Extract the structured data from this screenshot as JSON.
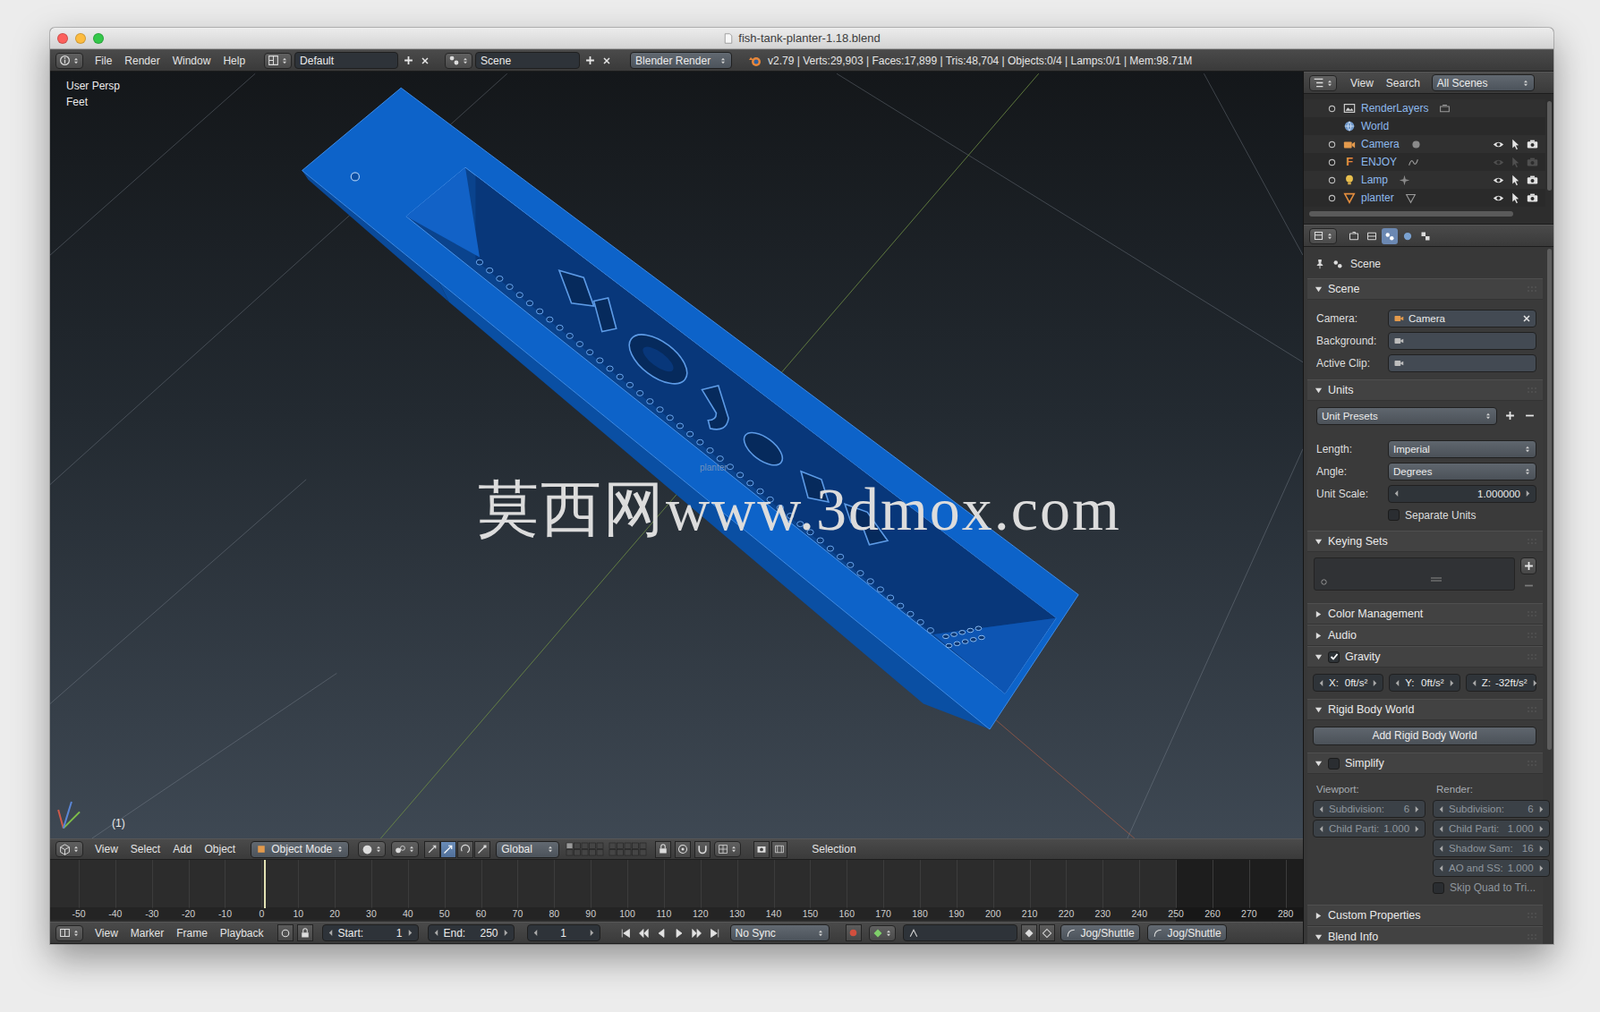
{
  "window": {
    "title": "fish-tank-planter-1.18.blend"
  },
  "info_header": {
    "menus": [
      "File",
      "Render",
      "Window",
      "Help"
    ],
    "layout": "Default",
    "scene": "Scene",
    "engine": "Blender Render",
    "stats": "v2.79 | Verts:29,903 | Faces:17,899 | Tris:48,704 | Objects:0/4 | Lamps:0/1 | Mem:98.71M"
  },
  "viewport": {
    "view": "User Persp",
    "units": "Feet",
    "frame": "(1)",
    "object_label": "planter",
    "watermark": "莫西网www.3dmox.com"
  },
  "viewport_header": {
    "menus": [
      "View",
      "Select",
      "Add",
      "Object"
    ],
    "mode": "Object Mode",
    "orientation": "Global",
    "selection_label": "Selection"
  },
  "timeline": {
    "ticks": [
      "-50",
      "-40",
      "-30",
      "-20",
      "-10",
      "0",
      "10",
      "20",
      "30",
      "40",
      "50",
      "60",
      "70",
      "80",
      "90",
      "100",
      "110",
      "120",
      "130",
      "140",
      "150",
      "160",
      "170",
      "180",
      "190",
      "200",
      "210",
      "220",
      "230",
      "240",
      "250",
      "260",
      "270",
      "280"
    ]
  },
  "timeline_header": {
    "menus": [
      "View",
      "Marker",
      "Frame",
      "Playback"
    ],
    "start_label": "Start:",
    "start": "1",
    "end_label": "End:",
    "end": "250",
    "current": "1",
    "sync": "No Sync",
    "jog": [
      "Jog/Shuttle",
      "Jog/Shuttle"
    ]
  },
  "outliner": {
    "menus": [
      "View",
      "Search"
    ],
    "filter": "All Scenes",
    "rows": [
      {
        "name": "RenderLayers",
        "kind": "renderlayers",
        "expandable": true,
        "restrict": false,
        "visible": true
      },
      {
        "name": "World",
        "kind": "world",
        "expandable": false,
        "restrict": false,
        "visible": true
      },
      {
        "name": "Camera",
        "kind": "camera",
        "expandable": true,
        "restrict": true,
        "visible": true
      },
      {
        "name": "ENJOY",
        "kind": "font",
        "glyph": "F",
        "expandable": true,
        "restrict": true,
        "visible": false
      },
      {
        "name": "Lamp",
        "kind": "lamp",
        "expandable": true,
        "restrict": true,
        "visible": true
      },
      {
        "name": "planter",
        "kind": "mesh",
        "expandable": true,
        "restrict": true,
        "visible": true
      }
    ]
  },
  "properties": {
    "context_tabs": [
      {
        "selected": false
      },
      {
        "selected": false
      },
      {
        "selected": true
      },
      {
        "selected": false
      },
      {
        "selected": false
      }
    ],
    "breadcrumb": "Scene",
    "panels": [
      {
        "kind": "scene",
        "title": "Scene",
        "expanded": true,
        "rows": [
          {
            "label": "Camera:",
            "value": "Camera",
            "filled": true
          },
          {
            "label": "Background:",
            "value": "",
            "filled": false
          },
          {
            "label": "Active Clip:",
            "value": "",
            "filled": false
          }
        ]
      },
      {
        "kind": "units",
        "title": "Units",
        "expanded": true,
        "preset": "Unit Presets",
        "rows": [
          {
            "label": "Length:",
            "value": "Imperial",
            "kind": "dropdown"
          },
          {
            "label": "Angle:",
            "value": "Degrees",
            "kind": "dropdown"
          },
          {
            "label": "Unit Scale:",
            "value": "1.000000",
            "kind": "number"
          }
        ],
        "option": {
          "label": "Separate Units",
          "checked": false
        }
      },
      {
        "kind": "keying",
        "title": "Keying Sets",
        "expanded": true
      },
      {
        "kind": "plain",
        "title": "Color Management",
        "expanded": false
      },
      {
        "kind": "plain",
        "title": "Audio",
        "expanded": false
      },
      {
        "kind": "gravity",
        "title": "Gravity",
        "expanded": true,
        "enabled": true,
        "fields": [
          {
            "label": "X:",
            "value": "0ft/s²"
          },
          {
            "label": "Y:",
            "value": "0ft/s²"
          },
          {
            "label": "Z:",
            "value": "-32ft/s²"
          }
        ]
      },
      {
        "kind": "button",
        "title": "Rigid Body World",
        "expanded": true,
        "button": "Add Rigid Body World"
      },
      {
        "kind": "simplify",
        "title": "Simplify",
        "expanded": true,
        "enabled": false,
        "columns": [
          {
            "heading": "Viewport:",
            "fields": [
              {
                "label": "Subdivision:",
                "value": "6"
              },
              {
                "label": "Child Parti:",
                "value": "1.000"
              }
            ]
          },
          {
            "heading": "Render:",
            "fields": [
              {
                "label": "Subdivision:",
                "value": "6"
              },
              {
                "label": "Child Parti:",
                "value": "1.000"
              },
              {
                "label": "Shadow Sam:",
                "value": "16"
              },
              {
                "label": "AO and SS:",
                "value": "1.000"
              }
            ],
            "option": {
              "label": "Skip Quad to Tri...",
              "checked": false
            }
          }
        ]
      },
      {
        "kind": "plain",
        "title": "Custom Properties",
        "expanded": false
      },
      {
        "kind": "plain",
        "title": "Blend Info",
        "expanded": true
      }
    ]
  }
}
